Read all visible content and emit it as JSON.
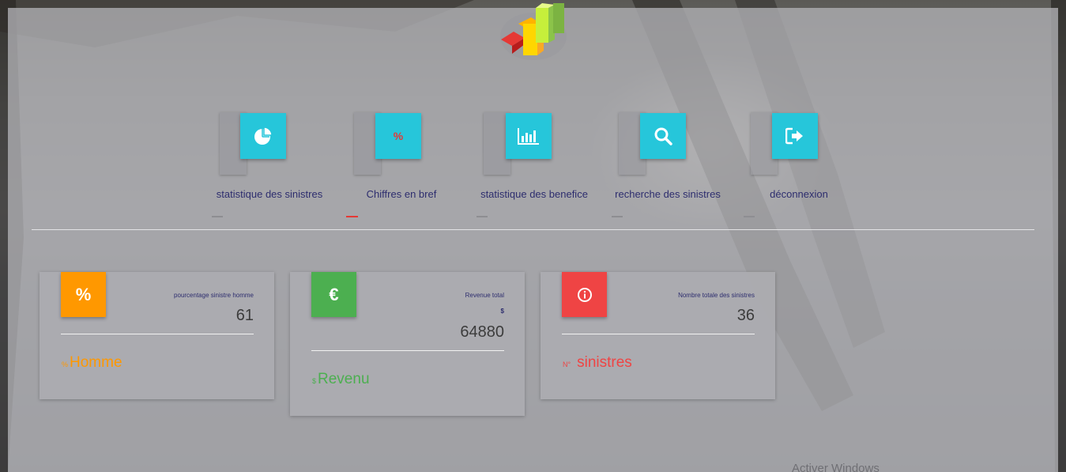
{
  "nav": {
    "items": [
      {
        "label": "statistique des sinistres",
        "icon": "pie-chart-icon",
        "active": false
      },
      {
        "label": "Chiffres en bref",
        "icon": "percent-icon",
        "active": true
      },
      {
        "label": "statistique des benefice",
        "icon": "bar-chart-icon",
        "active": false
      },
      {
        "label": "recherche des sinistres",
        "icon": "search-icon",
        "active": false
      },
      {
        "label": "déconnexion",
        "icon": "logout-icon",
        "active": false
      }
    ],
    "tile_color": "#26c6da",
    "active_color": "#e53935",
    "percent_glyph": "%"
  },
  "cards": [
    {
      "icon_glyph": "%",
      "icon": "percent-icon",
      "color": "#ff9800",
      "category": "pourcentage sinistre homme",
      "unit": "",
      "value": "61",
      "footer_prefix": "%",
      "footer_text": "Homme"
    },
    {
      "icon_glyph": "€",
      "icon": "euro-icon",
      "color": "#4caf50",
      "category": "Revenue total",
      "unit": "$",
      "value": "64880",
      "footer_prefix": "$",
      "footer_text": "Revenu"
    },
    {
      "icon_glyph": "i",
      "icon": "info-icon",
      "color": "#ef4444",
      "category": "Nombre totale des sinistres",
      "unit": "",
      "value": "36",
      "footer_prefix": "N°",
      "footer_text": "sinistres"
    }
  ],
  "watermark": "Activer Windows"
}
